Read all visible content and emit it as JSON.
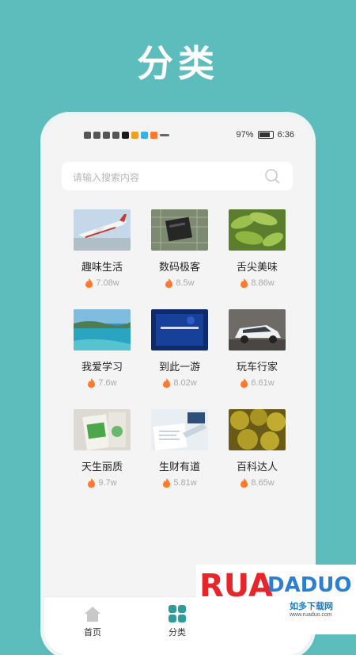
{
  "headline": "分类",
  "status_bar": {
    "battery": "97%",
    "time": "6:36"
  },
  "search": {
    "placeholder": "请输入搜索内容"
  },
  "categories": [
    {
      "title": "趣味生活",
      "count": "7.08w",
      "image": "airplane"
    },
    {
      "title": "数码极客",
      "count": "8.5w",
      "image": "circuit-board"
    },
    {
      "title": "舌尖美味",
      "count": "8.86w",
      "image": "edamame"
    },
    {
      "title": "我爱学习",
      "count": "7.6w",
      "image": "coast"
    },
    {
      "title": "到此一游",
      "count": "8.02w",
      "image": "blue-screen"
    },
    {
      "title": "玩车行家",
      "count": "6.61w",
      "image": "white-suv"
    },
    {
      "title": "天生丽质",
      "count": "9.7w",
      "image": "product-box"
    },
    {
      "title": "生财有道",
      "count": "5.81w",
      "image": "paperwork"
    },
    {
      "title": "百科达人",
      "count": "8.65w",
      "image": "durian"
    }
  ],
  "bottom_nav": [
    {
      "label": "首页",
      "icon": "home-icon"
    },
    {
      "label": "分类",
      "icon": "grid-icon"
    }
  ],
  "watermark": {
    "brand": "RUADADUO",
    "site_name": "如多下载网",
    "url": "www.ruaduo.com"
  },
  "colors": {
    "background": "#5dbdbd",
    "accent": "#2f9c9c",
    "fire": "#ff7a2a"
  }
}
